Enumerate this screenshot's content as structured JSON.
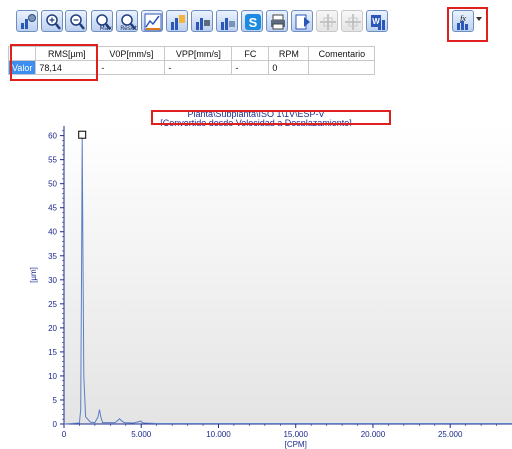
{
  "toolbar": {
    "buttons": [
      {
        "name": "chart-settings-button",
        "icon": "chart-gear-icon",
        "sub": ""
      },
      {
        "name": "zoom-in-button",
        "icon": "zoom-in-icon",
        "sub": ""
      },
      {
        "name": "zoom-out-button",
        "icon": "zoom-out-icon",
        "sub": ""
      },
      {
        "name": "zoom-max-button",
        "icon": "zoom-max-icon",
        "sub": "Max"
      },
      {
        "name": "zoom-reset-button",
        "icon": "zoom-reset-icon",
        "sub": "Reset"
      },
      {
        "name": "chart-type-button",
        "icon": "chart-line-icon",
        "sub": ""
      },
      {
        "name": "export-button",
        "icon": "chart-export-icon",
        "sub": ""
      },
      {
        "name": "print-chart-button",
        "icon": "chart-print-icon",
        "sub": ""
      },
      {
        "name": "chart-options-button",
        "icon": "chart-options-icon",
        "sub": ""
      },
      {
        "name": "skype-button",
        "icon": "s-icon",
        "sub": ""
      },
      {
        "name": "print-button",
        "icon": "printer-icon",
        "sub": ""
      },
      {
        "name": "report-button",
        "icon": "report-icon",
        "sub": ""
      },
      {
        "name": "cursor-button",
        "icon": "crosshair-icon",
        "sub": ""
      },
      {
        "name": "cursor-2-button",
        "icon": "crosshair-icon",
        "sub": ""
      },
      {
        "name": "word-export-button",
        "icon": "word-icon",
        "sub": ""
      },
      {
        "name": "function-button",
        "icon": "function-chart-icon",
        "sub": ""
      }
    ]
  },
  "table": {
    "headers": [
      "RMS[µm]",
      "V0P[mm/s]",
      "VPP[mm/s]",
      "FC",
      "RPM",
      "Comentario"
    ],
    "row_label": "Valor",
    "values": [
      "78,14",
      "-",
      "-",
      "-",
      "0",
      ""
    ]
  },
  "chart": {
    "title_line1": "Planta\\Subplanta\\ISO 1\\1V\\ESP-V",
    "title_line2": "[Convertido desde Velocidad a Desplazamiento]"
  },
  "colors": {
    "accent": "#1c2a8c",
    "highlight": "#e0201e",
    "line": "#5a7fc8"
  },
  "chart_data": {
    "type": "line",
    "title": "Planta\\Subplanta\\ISO 1\\1V\\ESP-V",
    "subtitle": "[Convertido desde Velocidad a Desplazamiento]",
    "xlabel": "[CPM]",
    "ylabel": "[µm]",
    "xlim": [
      0,
      29000
    ],
    "ylim": [
      0,
      62
    ],
    "xticks": [
      0,
      5000,
      10000,
      15000,
      20000,
      25000
    ],
    "xtick_labels": [
      "0",
      "5.000",
      "10.000",
      "15.000",
      "20.000",
      "25.000"
    ],
    "yticks": [
      0,
      5,
      10,
      15,
      20,
      25,
      30,
      35,
      40,
      45,
      50,
      55,
      60
    ],
    "grid": false,
    "series": [
      {
        "values_x": [
          0,
          1000,
          1080,
          1130,
          1180,
          1220,
          1280,
          1400,
          1700,
          2000,
          2200,
          2300,
          2380,
          2500,
          2800,
          3300,
          3500,
          3600,
          3700,
          3900,
          4500,
          4980,
          5050,
          5200,
          6000,
          8000,
          12000,
          20000,
          29000
        ],
        "values_y": [
          0,
          0.2,
          3,
          30,
          60.2,
          40,
          10,
          1.5,
          0.4,
          0.3,
          1.5,
          3,
          1.5,
          0.3,
          0.3,
          0.3,
          0.8,
          1.1,
          0.7,
          0.3,
          0.2,
          0.6,
          0.3,
          0.2,
          0.1,
          0.1,
          0.1,
          0.1,
          0.1
        ]
      }
    ],
    "marker": {
      "x": 1180,
      "y": 60.2
    }
  }
}
